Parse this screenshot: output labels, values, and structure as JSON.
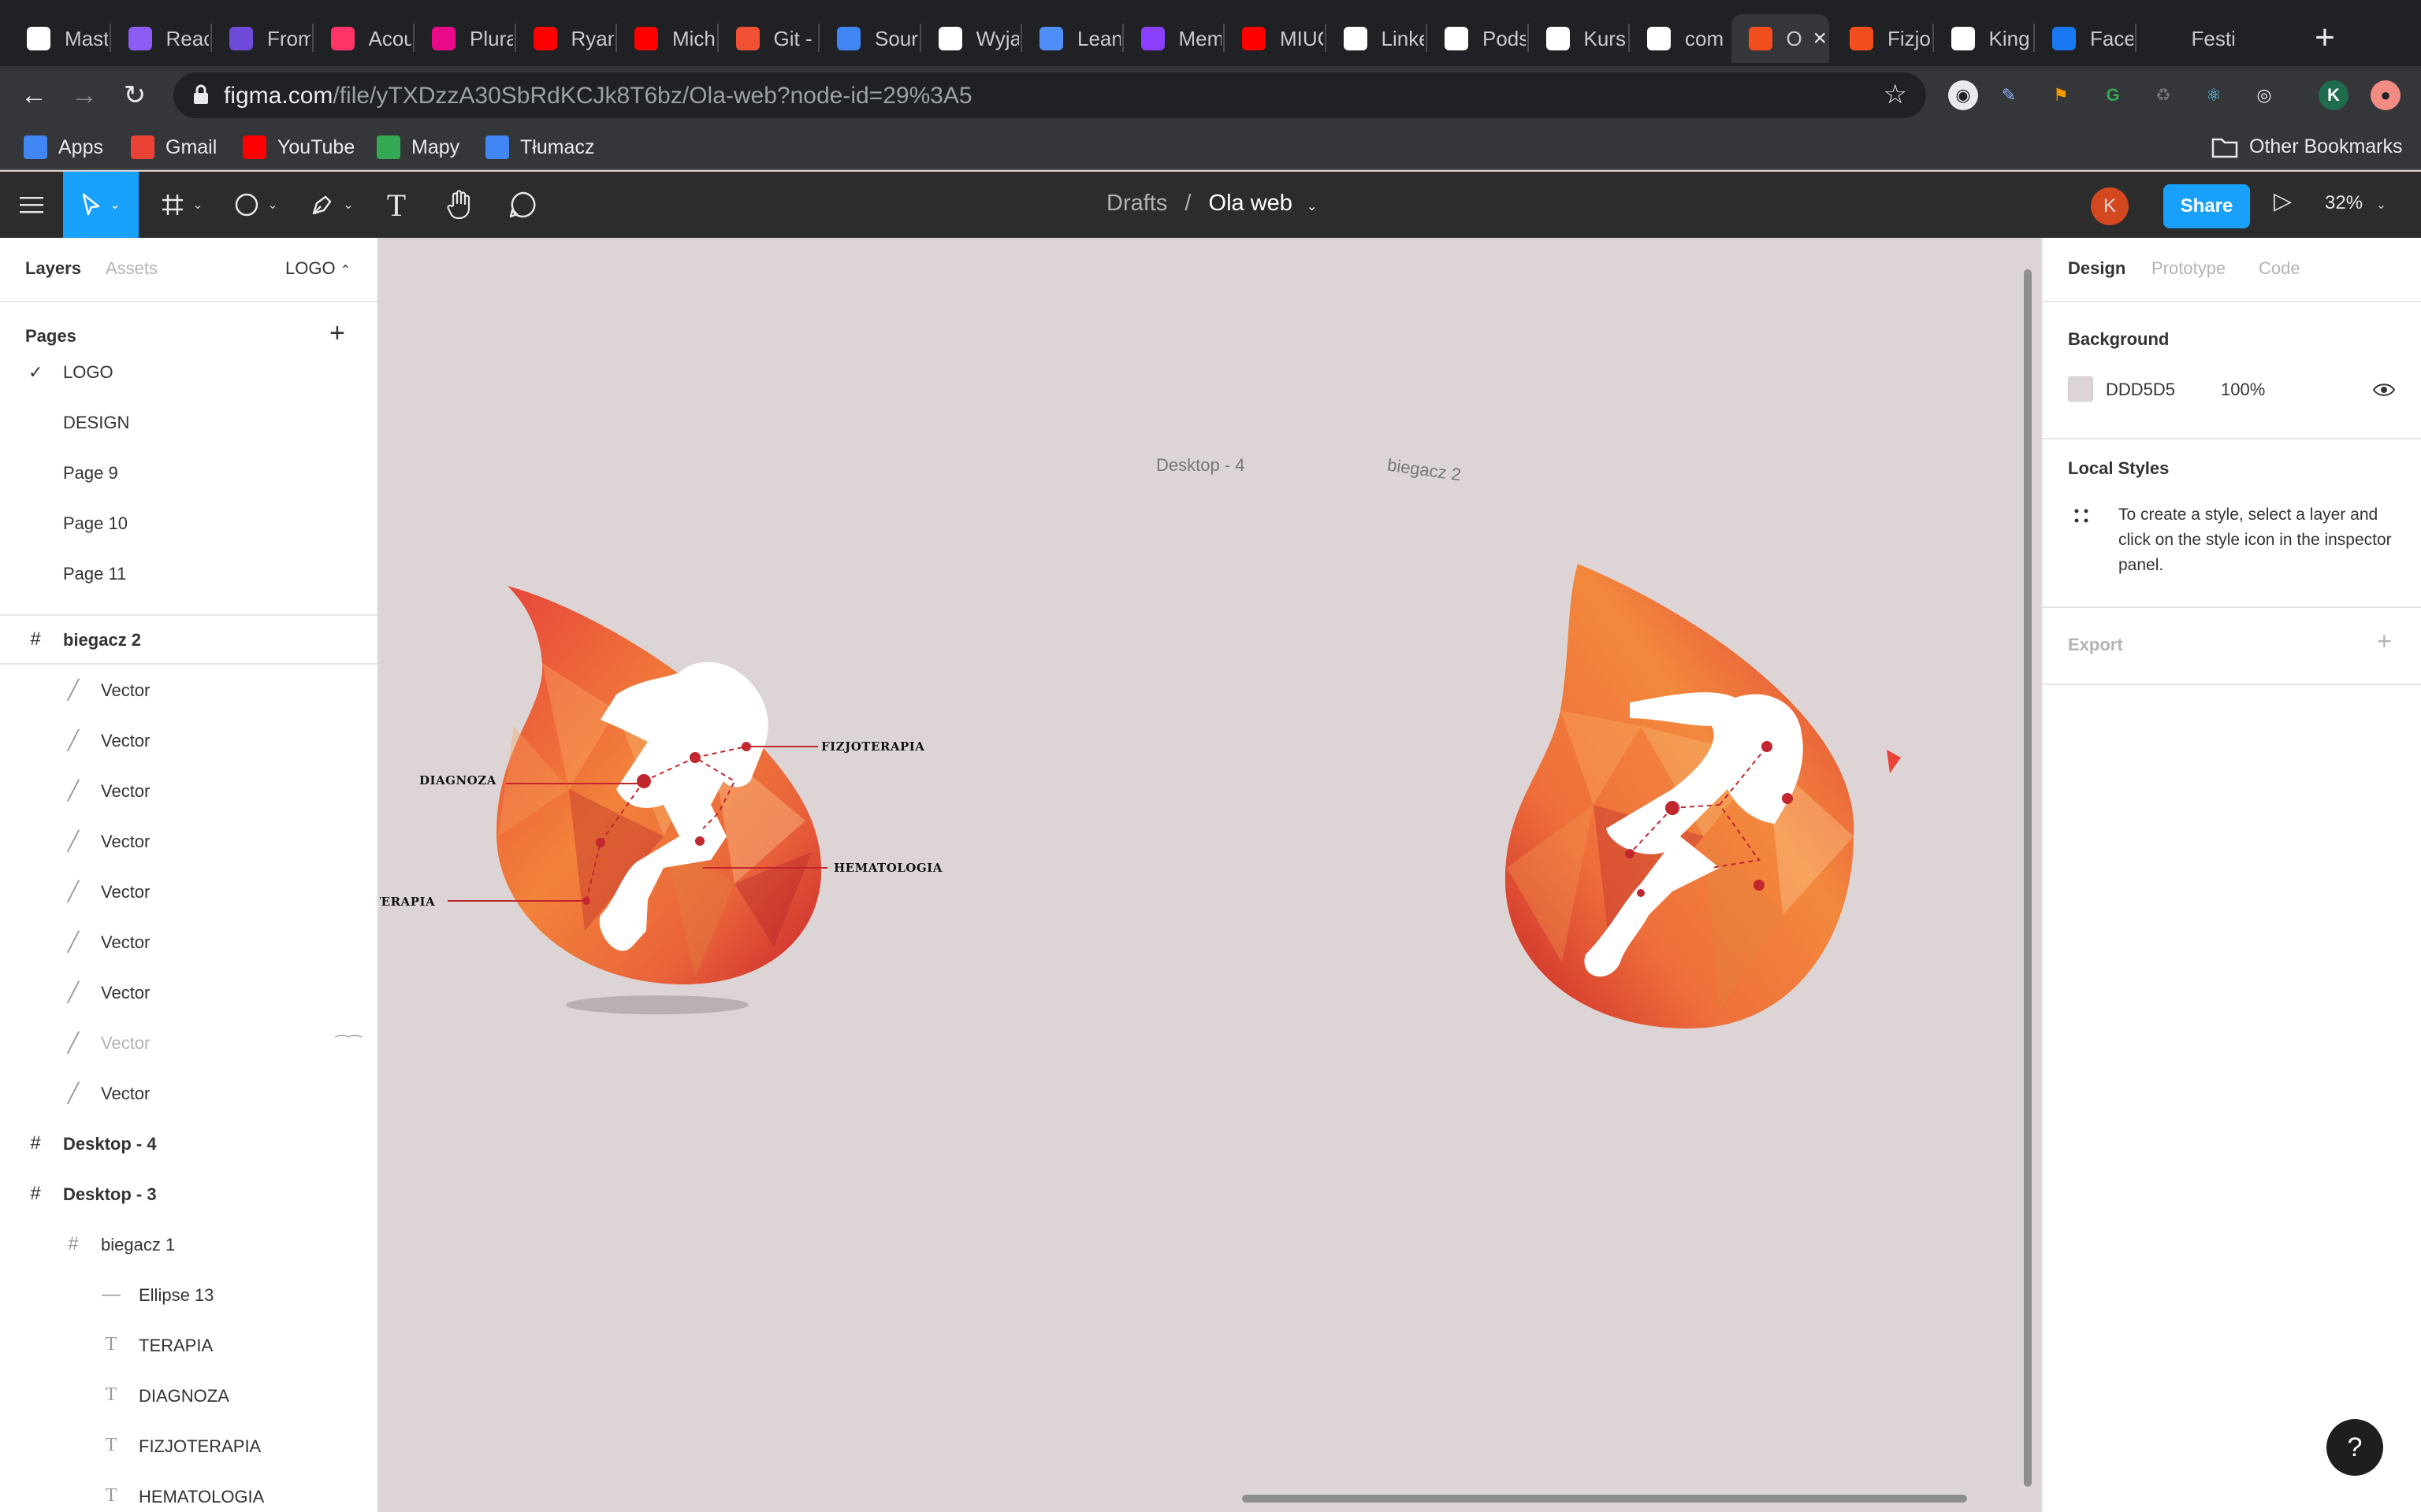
{
  "browser": {
    "tabs": [
      {
        "label": "Mast",
        "icon": "github-icon",
        "color": "#ffffff"
      },
      {
        "label": "Reac",
        "icon": "purple-i-icon",
        "color": "#8c5cf5"
      },
      {
        "label": "From",
        "icon": "rocket-icon",
        "color": "#6e4bd8"
      },
      {
        "label": "Acou",
        "icon": "invision-icon",
        "color": "#ff3366"
      },
      {
        "label": "Plura",
        "icon": "pluralsight-icon",
        "color": "#e80a89"
      },
      {
        "label": "Ryan",
        "icon": "youtube-icon",
        "color": "#ff0000"
      },
      {
        "label": "Mich",
        "icon": "youtube-icon",
        "color": "#ff0000"
      },
      {
        "label": "Git -",
        "icon": "git-icon",
        "color": "#f05033"
      },
      {
        "label": "Sour",
        "icon": "map-pin-icon",
        "color": "#4285f4"
      },
      {
        "label": "Wyja",
        "icon": "sequence-icon",
        "color": "#ffffff"
      },
      {
        "label": "Lean",
        "icon": "infinity-icon",
        "color": "#4f8ef7"
      },
      {
        "label": "Mem",
        "icon": "s-icon",
        "color": "#8a3ffc"
      },
      {
        "label": "MIUC",
        "icon": "youtube-icon",
        "color": "#ff0000"
      },
      {
        "label": "Linke",
        "icon": "page-icon",
        "color": "#ffffff"
      },
      {
        "label": "Pods",
        "icon": "typeweb-icon",
        "color": "#ffffff"
      },
      {
        "label": "Kurs",
        "icon": "typeweb-icon",
        "color": "#ffffff"
      },
      {
        "label": "com",
        "icon": "page-icon",
        "color": "#ffffff"
      },
      {
        "label": "O",
        "icon": "figma-icon",
        "color": "#f24e1e",
        "active": true
      },
      {
        "label": "Fizjo",
        "icon": "flame-icon",
        "color": "#f24e1e"
      },
      {
        "label": "King",
        "icon": "github-icon",
        "color": "#ffffff"
      },
      {
        "label": "Face",
        "icon": "facebook-icon",
        "color": "#1877f2"
      },
      {
        "label": "Festi",
        "icon": "blank-icon",
        "color": "#202124"
      }
    ],
    "url_host": "figma.com",
    "url_path": "/file/yTXDzzA30SbRdKCJk8T6bz/Ola-web?node-id=29%3A5",
    "profile_initial": "K",
    "bookmarks": [
      {
        "label": "Apps",
        "icon": "apps-grid-icon",
        "color": "#4285f4"
      },
      {
        "label": "Gmail",
        "icon": "gmail-icon",
        "color": "#ea4335"
      },
      {
        "label": "YouTube",
        "icon": "youtube-icon",
        "color": "#ff0000"
      },
      {
        "label": "Mapy",
        "icon": "maps-icon",
        "color": "#34a853"
      },
      {
        "label": "Tłumacz",
        "icon": "translate-icon",
        "color": "#4285f4"
      }
    ],
    "other_bookmarks": "Other Bookmarks"
  },
  "figma": {
    "breadcrumb_drafts": "Drafts",
    "breadcrumb_sep": "/",
    "file_name": "Ola web",
    "avatar_initial": "K",
    "share_label": "Share",
    "zoom": "32%",
    "accent": "#18a0fb"
  },
  "left_panel": {
    "tab_layers": "Layers",
    "tab_assets": "Assets",
    "current_page": "LOGO",
    "pages_title": "Pages",
    "pages": [
      "LOGO",
      "DESIGN",
      "Page 9",
      "Page 10",
      "Page 11"
    ],
    "layers": [
      {
        "name": "biegacz 2",
        "type": "frame",
        "indent": 0
      },
      {
        "name": "Vector",
        "type": "vector",
        "indent": 1
      },
      {
        "name": "Vector",
        "type": "vector",
        "indent": 1
      },
      {
        "name": "Vector",
        "type": "vector",
        "indent": 1
      },
      {
        "name": "Vector",
        "type": "vector",
        "indent": 1
      },
      {
        "name": "Vector",
        "type": "vector",
        "indent": 1
      },
      {
        "name": "Vector",
        "type": "vector",
        "indent": 1
      },
      {
        "name": "Vector",
        "type": "vector",
        "indent": 1
      },
      {
        "name": "Vector",
        "type": "vector",
        "indent": 1,
        "hidden": true
      },
      {
        "name": "Vector",
        "type": "vector",
        "indent": 1
      },
      {
        "name": "Desktop - 4",
        "type": "frame",
        "indent": 0
      },
      {
        "name": "Desktop - 3",
        "type": "frame",
        "indent": 0
      },
      {
        "name": "biegacz 1",
        "type": "frame",
        "indent": 1
      },
      {
        "name": "Ellipse 13",
        "type": "ellipse",
        "indent": 2
      },
      {
        "name": "TERAPIA",
        "type": "text",
        "indent": 2
      },
      {
        "name": "DIAGNOZA",
        "type": "text",
        "indent": 2
      },
      {
        "name": "FIZJOTERAPIA",
        "type": "text",
        "indent": 2
      },
      {
        "name": "HEMATOLOGIA",
        "type": "text",
        "indent": 2
      }
    ]
  },
  "canvas": {
    "frame_label_desktop4": "Desktop - 4",
    "frame_label_biegacz2": "biegacz 2",
    "callouts": {
      "diagnoza": "DIAGNOZA",
      "fizjoterapia": "FIZJOTERAPIA",
      "hematologia": "HEMATOLOGIA",
      "terapia": "TERAPIA"
    }
  },
  "right_panel": {
    "tab_design": "Design",
    "tab_prototype": "Prototype",
    "tab_code": "Code",
    "background_title": "Background",
    "bg_hex": "DDD5D5",
    "bg_opacity": "100%",
    "local_styles_title": "Local Styles",
    "local_styles_help": "To create a style, select a layer and click on the style icon in the inspector panel.",
    "export_title": "Export",
    "canvas_color": "#DDD5D5"
  },
  "help_label": "?"
}
